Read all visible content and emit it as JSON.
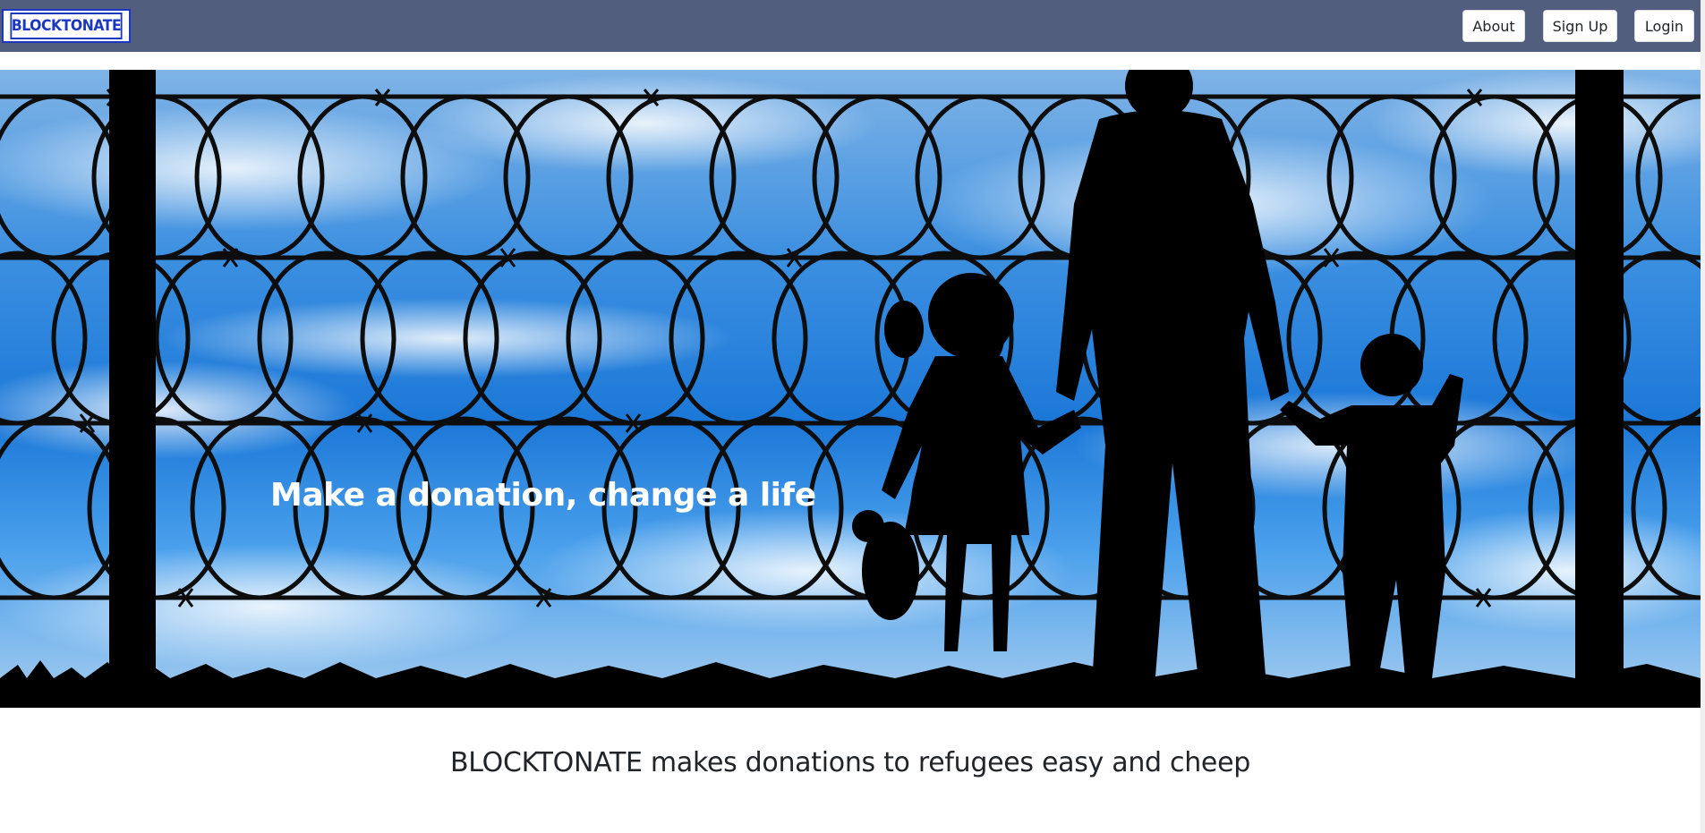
{
  "navbar": {
    "logo_text": "BLOCKTONATE",
    "buttons": {
      "about": "About",
      "signup": "Sign Up",
      "login": "Login"
    },
    "background": "#525e7e",
    "logo_color": "#1c37c2"
  },
  "hero": {
    "headline": "Make a donation, change a life",
    "image": "silhouette-family-behind-barbed-wire-fence"
  },
  "main": {
    "tagline": "BLOCKTONATE makes donations to refugees easy and cheep"
  }
}
